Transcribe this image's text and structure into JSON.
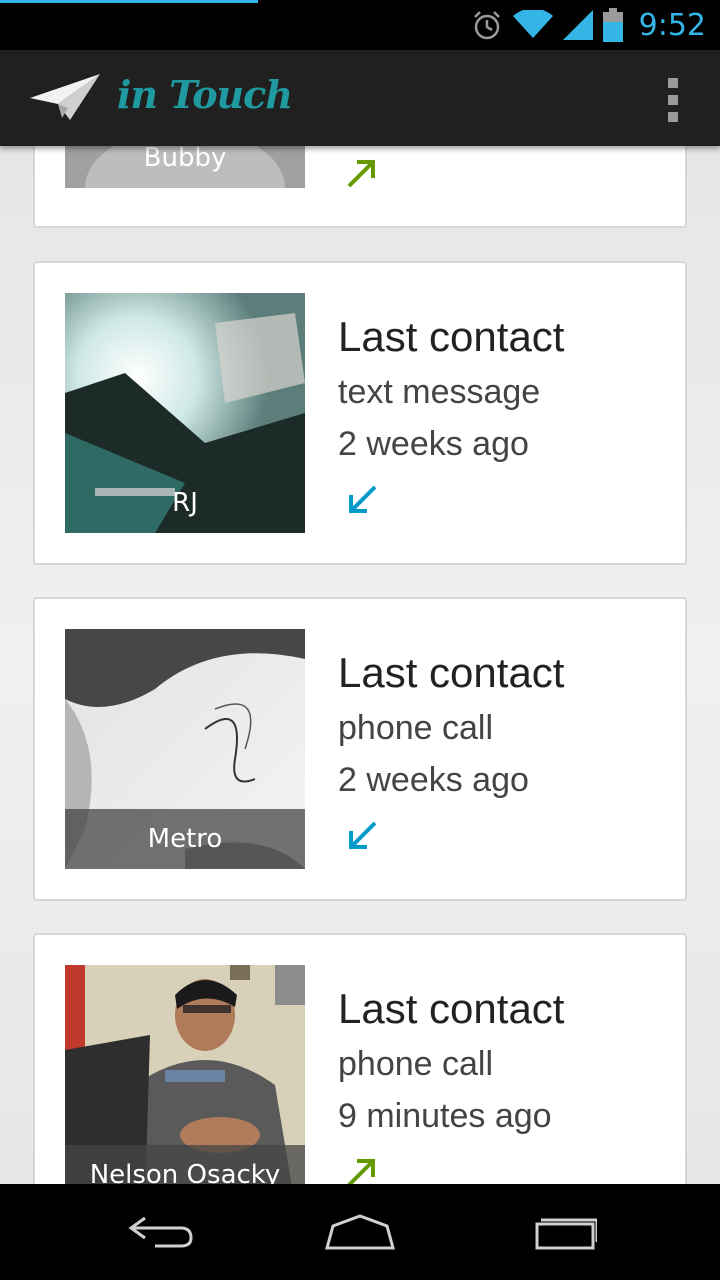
{
  "status_bar": {
    "time": "9:52",
    "icons": [
      "alarm-icon",
      "wifi-icon",
      "signal-icon",
      "battery-icon"
    ],
    "accent_color": "#33b5e5"
  },
  "action_bar": {
    "title": "in Touch",
    "logo_icon": "paper-plane-icon",
    "menu_icon": "overflow-menu-icon",
    "title_color": "#1e9aa0"
  },
  "contacts": [
    {
      "name": "Bubby",
      "direction": "outgoing",
      "direction_icon": "arrow-up-right-icon",
      "direction_color": "#669900"
    },
    {
      "name": "RJ",
      "title": "Last contact",
      "method": "text message",
      "when": "2 weeks ago",
      "direction": "incoming",
      "direction_icon": "arrow-down-left-icon",
      "direction_color": "#0099cc"
    },
    {
      "name": "Metro",
      "title": "Last contact",
      "method": "phone call",
      "when": "2 weeks ago",
      "direction": "incoming",
      "direction_icon": "arrow-down-left-icon",
      "direction_color": "#0099cc"
    },
    {
      "name": "Nelson Osacky",
      "title": "Last contact",
      "method": "phone call",
      "when": "9 minutes ago",
      "direction": "outgoing",
      "direction_icon": "arrow-up-right-icon",
      "direction_color": "#669900"
    }
  ],
  "nav_bar": {
    "buttons": [
      "back-icon",
      "home-icon",
      "recent-apps-icon"
    ]
  }
}
